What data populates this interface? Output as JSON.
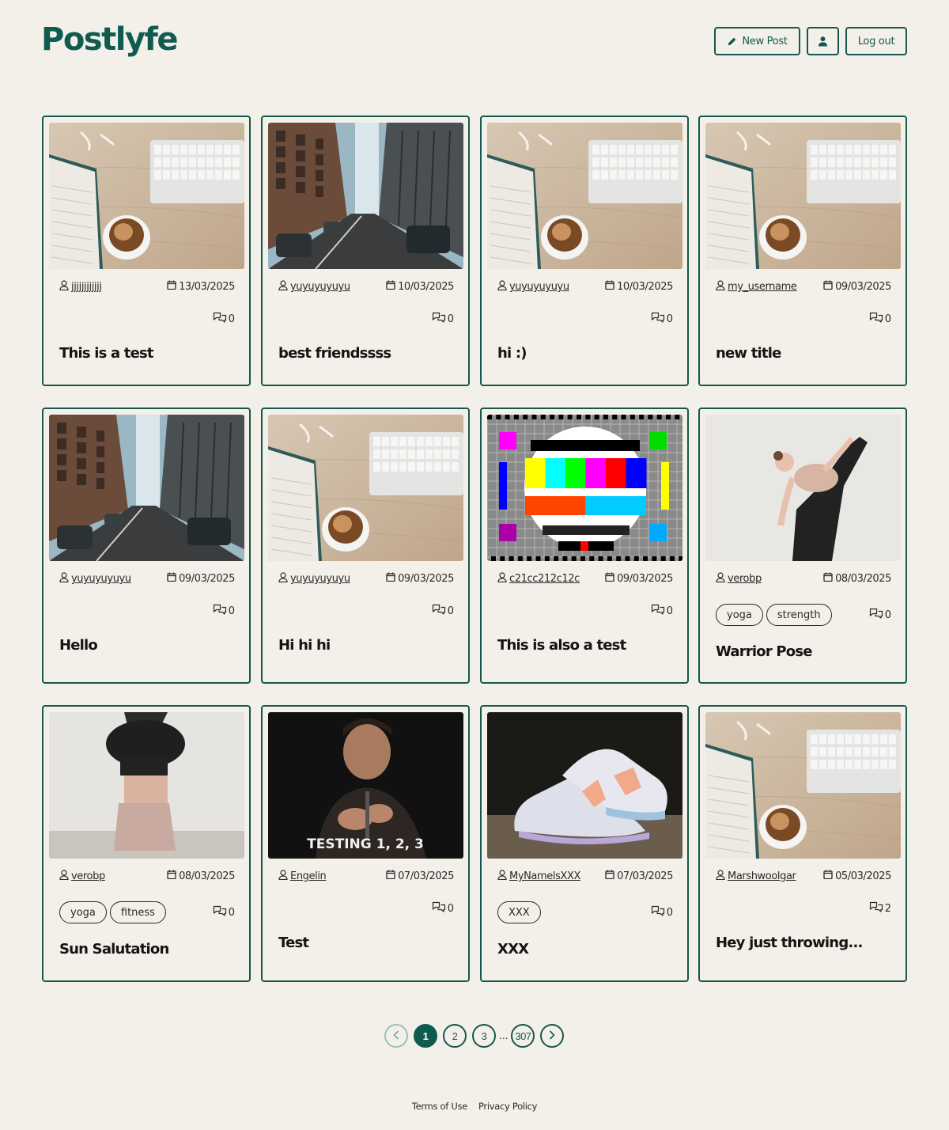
{
  "app": {
    "logo": "Postlyfe"
  },
  "header": {
    "new_post_label": "New Post",
    "logout_label": "Log out"
  },
  "posts": [
    {
      "author": "jjjjjjjjjjjj",
      "date": "13/03/2025",
      "comments": "0",
      "title": "This is a test",
      "tags": [],
      "image": "desk"
    },
    {
      "author": "yuyuyuyuyu",
      "date": "10/03/2025",
      "comments": "0",
      "title": "best friendssss",
      "tags": [],
      "image": "street"
    },
    {
      "author": "yuyuyuyuyu",
      "date": "10/03/2025",
      "comments": "0",
      "title": "hi :)",
      "tags": [],
      "image": "desk"
    },
    {
      "author": "my_username",
      "date": "09/03/2025",
      "comments": "0",
      "title": "new title",
      "tags": [],
      "image": "desk"
    },
    {
      "author": "yuyuyuyuyu",
      "date": "09/03/2025",
      "comments": "0",
      "title": "Hello",
      "tags": [],
      "image": "street"
    },
    {
      "author": "yuyuyuyuyu",
      "date": "09/03/2025",
      "comments": "0",
      "title": "Hi hi hi",
      "tags": [],
      "image": "desk-right"
    },
    {
      "author": "c21cc212c12c",
      "date": "09/03/2025",
      "comments": "0",
      "title": "This is also a test",
      "tags": [],
      "image": "testcard"
    },
    {
      "author": "verobp",
      "date": "08/03/2025",
      "comments": "0",
      "title": "Warrior Pose",
      "tags": [
        "yoga",
        "strength"
      ],
      "image": "yoga-stand"
    },
    {
      "author": "verobp",
      "date": "08/03/2025",
      "comments": "0",
      "title": "Sun Salutation",
      "tags": [
        "yoga",
        "fitness"
      ],
      "image": "yoga-head"
    },
    {
      "author": "Engelin",
      "date": "07/03/2025",
      "comments": "0",
      "title": "Test",
      "tags": [],
      "image": "testing",
      "image_caption": "TESTING 1, 2, 3"
    },
    {
      "author": "MyNamelsXXX",
      "date": "07/03/2025",
      "comments": "0",
      "title": "XXX",
      "tags": [
        "XXX"
      ],
      "image": "sneaker"
    },
    {
      "author": "Marshwoolgar",
      "date": "05/03/2025",
      "comments": "2",
      "title": "Hey just throwing...",
      "tags": [],
      "image": "desk"
    }
  ],
  "pagination": {
    "pages": [
      "1",
      "2",
      "3"
    ],
    "ellipsis": "...",
    "last": "307",
    "current": "1"
  },
  "footer": {
    "terms": "Terms of Use",
    "privacy": "Privacy Policy"
  },
  "colors": {
    "brand": "#0f5b50",
    "border": "#16584d",
    "background": "#f3f0ea"
  }
}
